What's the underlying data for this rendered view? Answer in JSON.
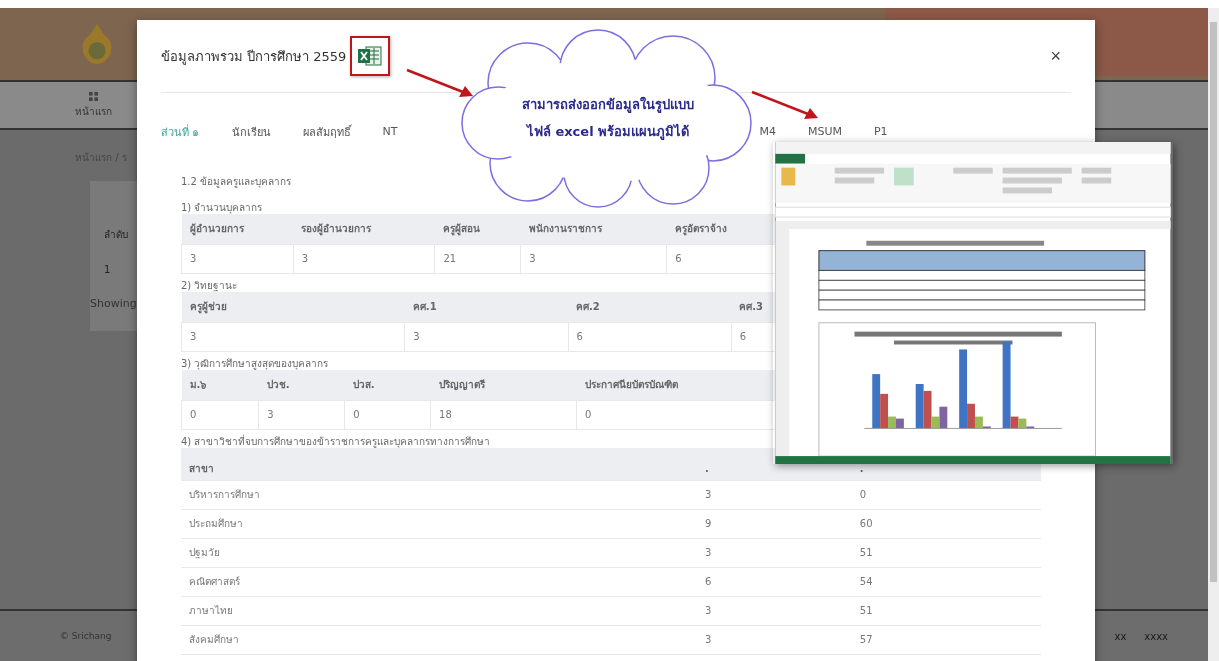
{
  "background": {
    "nav_label": "หน้าแรก",
    "breadcrumb": "หน้าแรก / ร",
    "table_header": "ลำดับ",
    "table_cell": "1",
    "showing": "Showing",
    "footer": "© Srichang",
    "footer_right": [
      "xx",
      "xxxx"
    ]
  },
  "modal": {
    "title": "ข้อมูลภาพรวม ปีการศึกษา 2559",
    "close": "×",
    "tabs": [
      {
        "label": "ส่วนที่ ๑",
        "selected": true
      },
      {
        "label": "นักเรียน",
        "selected": false
      },
      {
        "label": "ผลสัมฤทธิ์",
        "selected": false
      },
      {
        "label": "NT",
        "selected": false
      },
      {
        "label": "M4",
        "selected": false
      },
      {
        "label": "MSUM",
        "selected": false
      },
      {
        "label": "P1",
        "selected": false
      }
    ],
    "section_title": "1.2 ข้อมูลครูและบุคลากร",
    "tables": [
      {
        "caption": "1) จำนวนบุคลากร",
        "columns": [
          "ผู้อำนวยการ",
          "รองผู้อำนวยการ",
          "ครูผู้สอน",
          "พนักงานราชการ",
          "ครูอัตราจ้าง"
        ],
        "rows": [
          [
            "3",
            "3",
            "21",
            "3",
            "6"
          ]
        ]
      },
      {
        "caption": "2) วิทยฐานะ",
        "columns": [
          "ครูผู้ช่วย",
          "คศ.1",
          "คศ.2",
          "คศ.3"
        ],
        "rows": [
          [
            "3",
            "3",
            "6",
            "6"
          ]
        ]
      },
      {
        "caption": "3) วุฒิการศึกษาสูงสุดของบุคลากร",
        "columns": [
          "ม.๖",
          "ปวช.",
          "ปวส.",
          "ปริญญาตรี",
          "ประกาศนียบัตรบัณฑิต"
        ],
        "rows": [
          [
            "0",
            "3",
            "0",
            "18",
            "0"
          ]
        ]
      },
      {
        "caption": "4) สาขาวิชาที่จบการศึกษาของข้าราชการครูและบุคลากรทางการศึกษา",
        "columns": [
          "สาขา",
          ".",
          "."
        ],
        "rows": [
          [
            "บริหารการศึกษา",
            "3",
            "0"
          ],
          [
            "ประถมศึกษา",
            "9",
            "60"
          ],
          [
            "ปฐมวัย",
            "3",
            "51"
          ],
          [
            "คณิตศาสตร์",
            "6",
            "54"
          ],
          [
            "ภาษาไทย",
            "3",
            "51"
          ],
          [
            "สังคมศึกษา",
            "3",
            "57"
          ]
        ]
      }
    ]
  },
  "callout": {
    "lines": [
      "สามารถส่งออกข้อมูลในรูปแบบ",
      "ไฟล์ excel พร้อมแผนภูมิได้"
    ]
  }
}
